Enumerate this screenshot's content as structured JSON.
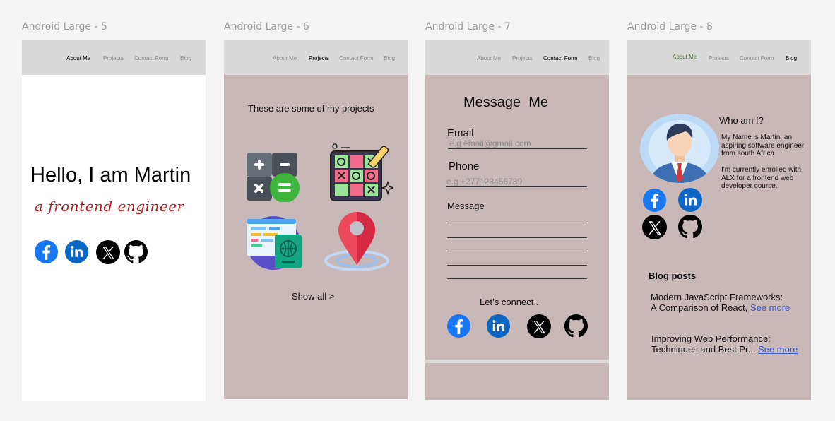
{
  "frames": [
    {
      "label": "Android Large - 5"
    },
    {
      "label": "Android Large - 6"
    },
    {
      "label": "Android Large - 7"
    },
    {
      "label": "Android Large - 8"
    }
  ],
  "nav": {
    "about": "About Me",
    "projects": "Projects",
    "contact": "Contact Form",
    "blog": "Blog"
  },
  "home": {
    "greeting": "Hello, I am Martin",
    "role": "a frontend engineer"
  },
  "projects": {
    "heading": "These are some of my projects",
    "show_all": "Show all >"
  },
  "contact": {
    "heading": "Message  Me",
    "email_label": "Email",
    "email_placeholder": "e.g email@gmail.com",
    "phone_label": "Phone",
    "phone_placeholder": "e.g +277123456789",
    "message_label": "Message",
    "connect": "Let’s connect..."
  },
  "blog": {
    "who_title": "Who am I?",
    "bio_1": [
      "My Name is Martin, an",
      "aspiring software engineer",
      "from south Africa"
    ],
    "bio_2": [
      "I'm currently enrolled with",
      "ALX for a frontend web",
      "developer course."
    ],
    "posts_title": "Blog posts",
    "post_1": {
      "line1": "Modern JavaScript Frameworks:",
      "line2": "A Comparison of React, ",
      "link": "See more"
    },
    "post_2": {
      "line1": "Improving Web Performance:",
      "line2": "Techniques and Best Pr... ",
      "link": "See more"
    }
  },
  "colors": {
    "facebook": "#1877f2",
    "linkedin": "#0a66c2",
    "accent_red": "#b5201f",
    "link": "#3a59c9"
  },
  "icons": [
    "facebook-icon",
    "linkedin-icon",
    "x-icon",
    "github-icon",
    "calculator-icon",
    "tic-tac-toe-icon",
    "web-passport-icon",
    "location-pin-icon",
    "avatar"
  ]
}
